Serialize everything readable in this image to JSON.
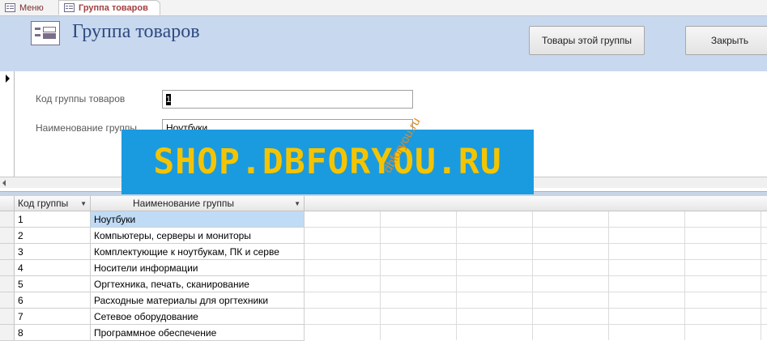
{
  "tabs": [
    {
      "label": "Меню",
      "active": false,
      "icon": "form-icon"
    },
    {
      "label": "Группа товаров",
      "active": true,
      "icon": "form-icon"
    }
  ],
  "header": {
    "title": "Группа товаров",
    "icon": "form-icon",
    "buttons": {
      "group_products": "Товары этой группы",
      "close": "Закрыть"
    }
  },
  "form": {
    "group_code_label": "Код группы товаров",
    "group_code_value": "1",
    "group_name_label": "Наименование группы",
    "group_name_value": "Ноутбуки"
  },
  "datasheet": {
    "columns": [
      "Код группы",
      "Наименование группы"
    ],
    "rows": [
      [
        "1",
        "Ноутбуки"
      ],
      [
        "2",
        "Компьютеры, серверы и мониторы"
      ],
      [
        "3",
        "Комплектующие к ноутбукам, ПК и серве"
      ],
      [
        "4",
        "Носители информации"
      ],
      [
        "5",
        "Оргтехника, печать, сканирование"
      ],
      [
        "6",
        "Расходные материалы для оргтехники"
      ],
      [
        "7",
        "Сетевое оборудование"
      ],
      [
        "8",
        "Программное обеспечение"
      ]
    ],
    "selected_row": 0
  },
  "watermark": {
    "banner_text": "SHOP.DBFORYOU.RU",
    "diagonal_text": "dbforyou.ru"
  },
  "colors": {
    "header_bg": "#c8d8ee",
    "title_color": "#2e4a80",
    "selected_cell": "#c0dbf5",
    "banner_bg": "#1a9be0",
    "banner_text": "#f5c400",
    "tab_text": "#a43f3f"
  }
}
